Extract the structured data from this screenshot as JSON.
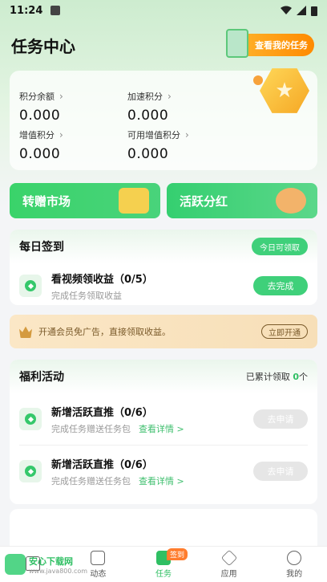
{
  "status_bar": {
    "time": "11:24"
  },
  "header": {
    "title": "任务中心",
    "my_task_button": "查看我的任务"
  },
  "points": [
    {
      "label": "积分余额",
      "value": "0.000"
    },
    {
      "label": "加速积分",
      "value": "0.000"
    },
    {
      "label": "增值积分",
      "value": "0.000"
    },
    {
      "label": "可用增值积分",
      "value": "0.000"
    }
  ],
  "promos": {
    "left": "转赠市场",
    "right": "活跃分红"
  },
  "daily_checkin": {
    "title": "每日签到",
    "pill": "今日可领取",
    "task": {
      "title": "看视频领收益（0/5）",
      "subtitle": "完成任务领取收益",
      "button": "去完成"
    }
  },
  "vip": {
    "text": "开通会员免广告，直接领取收益。",
    "button": "立即开通"
  },
  "welfare": {
    "title": "福利活动",
    "claimed_label": "已累计领取",
    "claimed_count": "0",
    "claimed_unit": "个",
    "tasks": [
      {
        "title": "新增活跃直推（0/6）",
        "subtitle": "完成任务赠送任务包",
        "link": "查看详情 >",
        "button": "去申请"
      },
      {
        "title": "新增活跃直推（0/6）",
        "subtitle": "完成任务赠送任务包",
        "link": "查看详情 >",
        "button": "去申请"
      }
    ]
  },
  "tabs": [
    {
      "label": "",
      "icon": "home-icon"
    },
    {
      "label": "动态",
      "icon": "feed-icon"
    },
    {
      "label": "任务",
      "icon": "task-icon",
      "tag": "签到"
    },
    {
      "label": "应用",
      "icon": "apps-icon"
    },
    {
      "label": "我的",
      "icon": "profile-icon"
    }
  ],
  "watermark": {
    "name": "安心下载网",
    "url": "www.java800.com"
  }
}
